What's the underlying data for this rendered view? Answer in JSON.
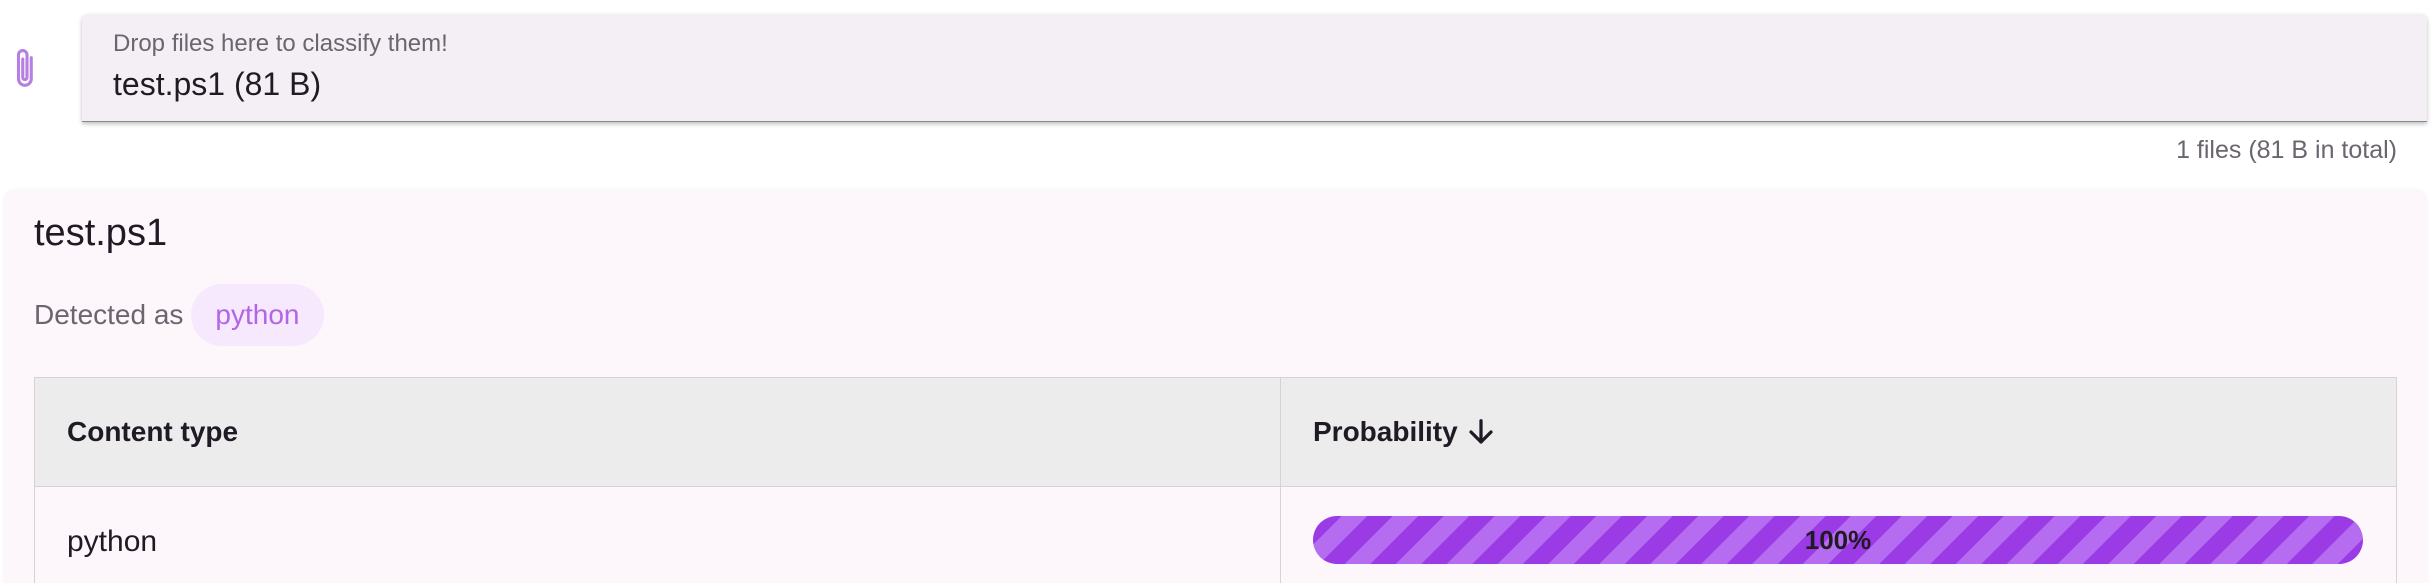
{
  "upload": {
    "icon": "paperclip-icon",
    "label": "Drop files here to classify them!",
    "value": "test.ps1 (81 B)",
    "summary": "1 files (81 B in total)"
  },
  "result": {
    "filename": "test.ps1",
    "detected_label": "Detected as",
    "detected_type": "python",
    "table": {
      "headers": [
        "Content type",
        "Probability"
      ],
      "sort_icon": "arrow-down-icon",
      "rows": [
        {
          "content_type": "python",
          "probability": 1.0,
          "probability_label": "100%"
        }
      ]
    }
  },
  "colors": {
    "accent": "#9b3be6",
    "chip_bg": "#f6e8fd",
    "chip_text": "#b266e6"
  }
}
